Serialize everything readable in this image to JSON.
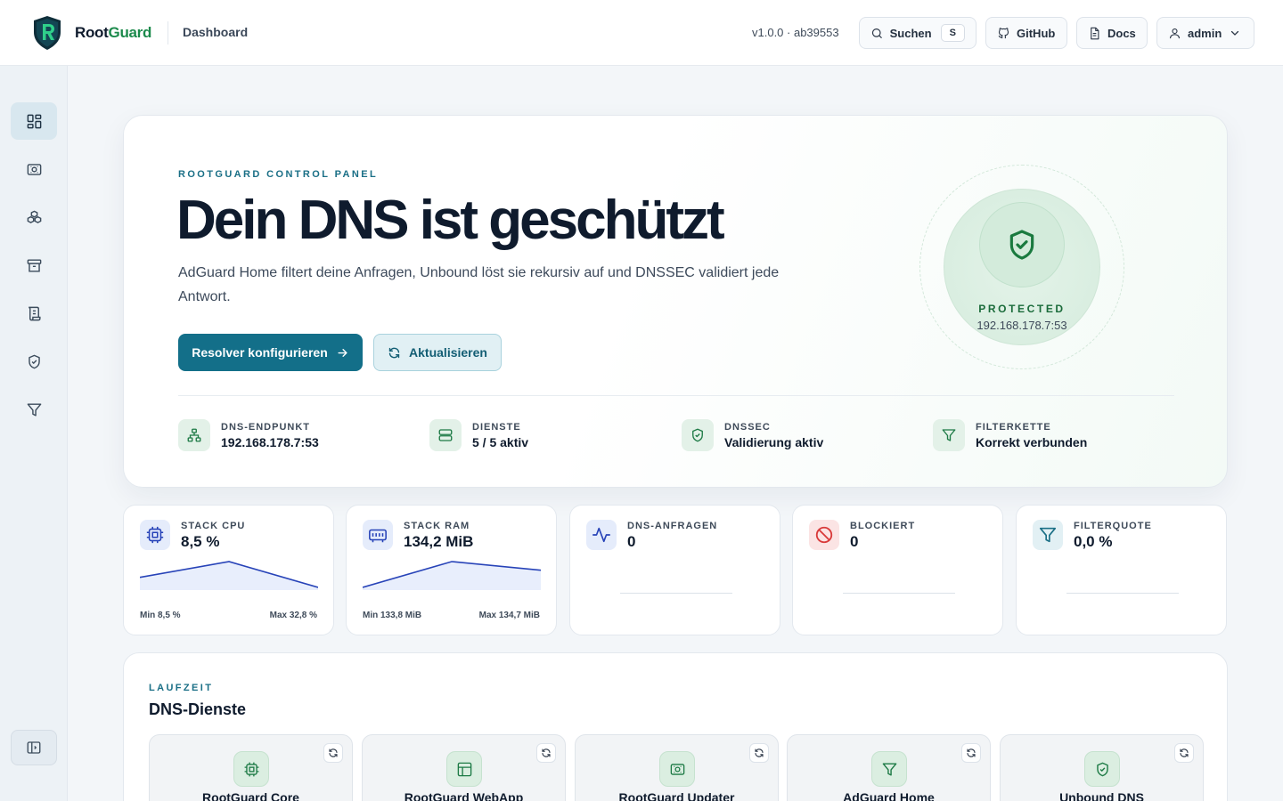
{
  "header": {
    "brand_root": "Root",
    "brand_guard": "Guard",
    "breadcrumb": "Dashboard",
    "version": "v1.0.0 · ab39553",
    "search_label": "Suchen",
    "search_shortcut": "S",
    "github_label": "GitHub",
    "docs_label": "Docs",
    "user_label": "admin"
  },
  "sidebar": {
    "items": [
      {
        "icon": "dashboard-icon",
        "active": true
      },
      {
        "icon": "router-icon"
      },
      {
        "icon": "containers-icon"
      },
      {
        "icon": "archive-icon"
      },
      {
        "icon": "logs-icon"
      },
      {
        "icon": "shield-icon"
      },
      {
        "icon": "filter-icon"
      }
    ],
    "collapse_icon": "sidebar-collapse-icon"
  },
  "hero": {
    "eyebrow": "ROOTGUARD CONTROL PANEL",
    "title": "Dein DNS ist geschützt",
    "description": "AdGuard Home filtert deine Anfragen, Unbound löst sie rekursiv auf und DNSSEC validiert jede Antwort.",
    "primary_button": "Resolver konfigurieren",
    "secondary_button": "Aktualisieren",
    "status_label": "PROTECTED",
    "status_ip": "192.168.178.7:53",
    "stats": [
      {
        "label": "DNS-ENDPUNKT",
        "value": "192.168.178.7:53",
        "icon": "network-icon"
      },
      {
        "label": "DIENSTE",
        "value": "5 / 5 aktiv",
        "icon": "server-icon"
      },
      {
        "label": "DNSSEC",
        "value": "Validierung aktiv",
        "icon": "shield-icon"
      },
      {
        "label": "FILTERKETTE",
        "value": "Korrekt verbunden",
        "icon": "filter-icon"
      }
    ]
  },
  "metrics": [
    {
      "label": "STACK CPU",
      "value": "8,5 %",
      "min": "Min 8,5 %",
      "max": "Max 32,8 %",
      "icon": "cpu-icon",
      "series": [
        18,
        32.8,
        8.5
      ]
    },
    {
      "label": "STACK RAM",
      "value": "134,2 MiB",
      "min": "Min 133,8 MiB",
      "max": "Max 134,7 MiB",
      "icon": "memory-icon",
      "series": [
        133.8,
        134.7,
        134.4
      ]
    },
    {
      "label": "DNS-ANFRAGEN",
      "value": "0",
      "icon": "activity-icon"
    },
    {
      "label": "BLOCKIERT",
      "value": "0",
      "icon": "blocked-icon"
    },
    {
      "label": "FILTERQUOTE",
      "value": "0,0 %",
      "icon": "filter-icon"
    }
  ],
  "runtime": {
    "eyebrow": "LAUFZEIT",
    "title": "DNS-Dienste",
    "services": [
      {
        "name": "RootGuard Core",
        "icon": "cpu-icon"
      },
      {
        "name": "RootGuard WebApp",
        "icon": "layout-icon"
      },
      {
        "name": "RootGuard Updater",
        "icon": "router-icon"
      },
      {
        "name": "AdGuard Home",
        "icon": "filter-icon"
      },
      {
        "name": "Unbound DNS",
        "icon": "shield-icon"
      }
    ]
  },
  "colors": {
    "accent": "#136f89",
    "brand_green": "#1c8a4c",
    "spark_line": "#2743b8",
    "danger": "#d93b3b"
  }
}
